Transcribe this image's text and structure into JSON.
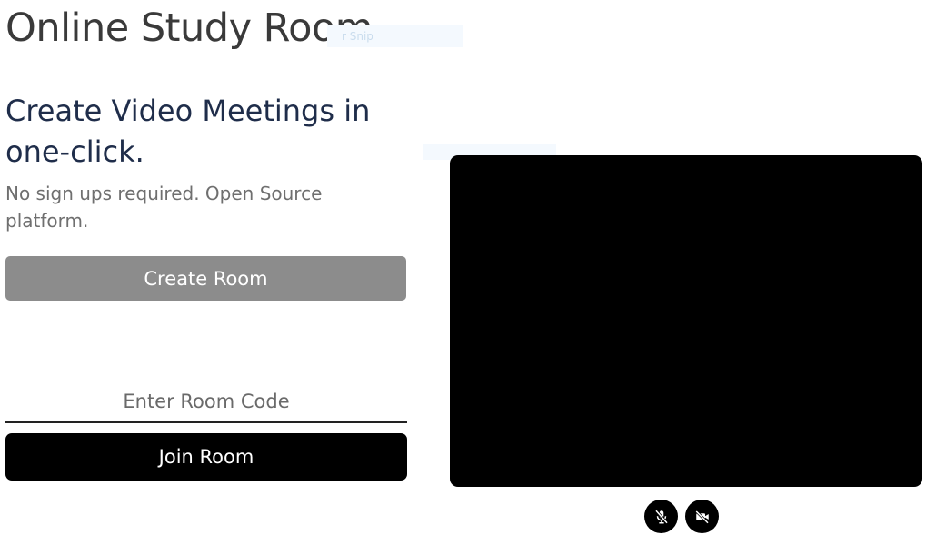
{
  "app": {
    "title": "Online Study Room"
  },
  "overlay": {
    "snip_text": "r Snip"
  },
  "hero": {
    "headline": "Create Video Meetings in one-click.",
    "subtext": "No sign ups required. Open Source platform."
  },
  "actions": {
    "create_label": "Create Room",
    "room_code_placeholder": "Enter Room Code",
    "room_code_value": "",
    "join_label": "Join Room"
  },
  "video": {
    "mic_icon": "mic-off-icon",
    "camera_icon": "video-off-icon"
  },
  "colors": {
    "title": "#3a3a3a",
    "headline": "#1f2d4a",
    "create_button": "#8c8c8c",
    "join_button": "#000000",
    "video_background": "#000000"
  }
}
